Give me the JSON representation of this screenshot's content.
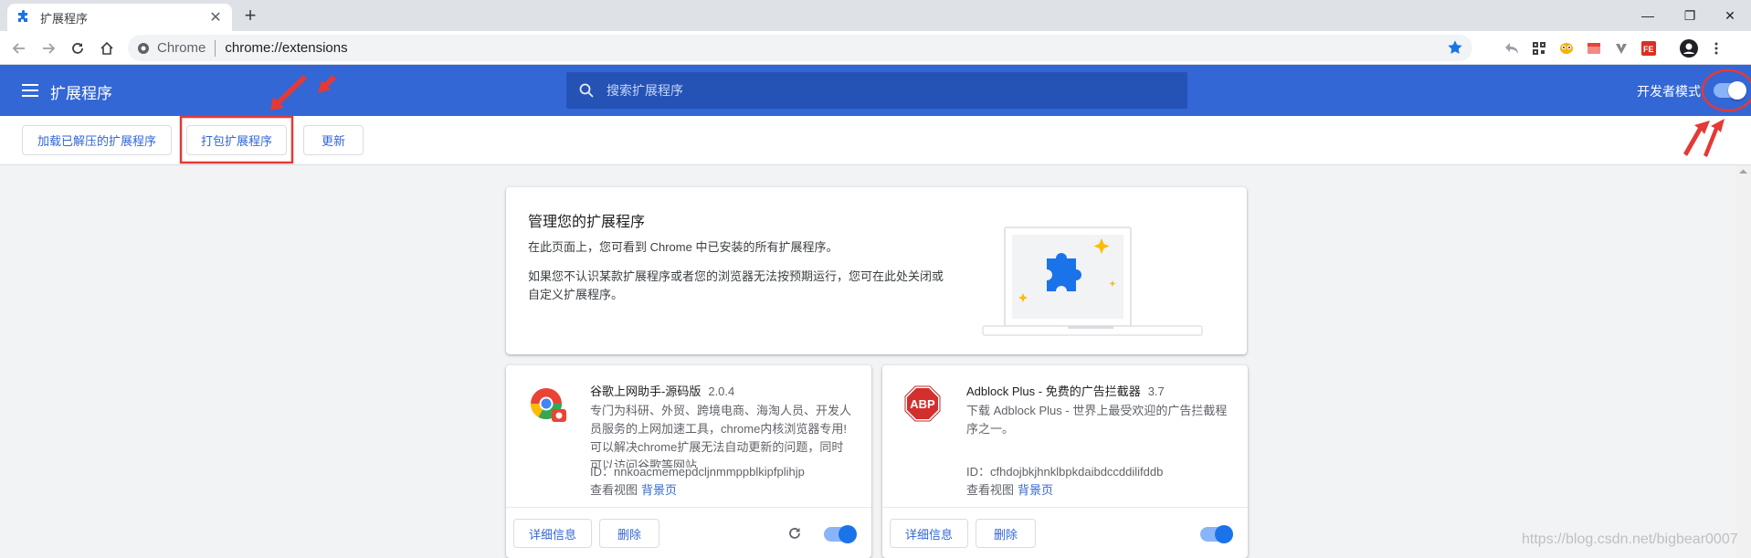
{
  "browser": {
    "tab_title": "扩展程序",
    "new_tab_symbol": "+",
    "omnibox_chip": "Chrome",
    "url": "chrome://extensions",
    "window_controls": [
      "minimize-icon",
      "restore-icon",
      "close-icon"
    ]
  },
  "colors": {
    "header_blue": "#3367d6",
    "link_blue": "#3367d6",
    "annotation_red": "#e53935",
    "star_blue": "#1a73e8"
  },
  "header": {
    "title": "扩展程序",
    "search_placeholder": "搜索扩展程序",
    "dev_mode_label": "开发者模式",
    "dev_mode_on": true
  },
  "devbar": {
    "load_unpacked": "加载已解压的扩展程序",
    "pack": "打包扩展程序",
    "update": "更新"
  },
  "manager_card": {
    "title": "管理您的扩展程序",
    "line1": "在此页面上，您可看到 Chrome 中已安装的所有扩展程序。",
    "line2": "如果您不认识某款扩展程序或者您的浏览器无法按预期运行，您可在此处关闭或",
    "line3": "自定义扩展程序。"
  },
  "extensions": [
    {
      "name": "谷歌上网助手-源码版",
      "version": "2.0.4",
      "desc_lines": [
        "专门为科研、外贸、跨境电商、海淘人员、开发人",
        "员服务的上网加速工具，chrome内核浏览器专用!",
        "可以解决chrome扩展无法自动更新的问题，同时",
        "可以访问谷歌等网站…"
      ],
      "id": "ID：nnkoacmemepdcljnmmppblkipfplihjp",
      "views_label": "查看视图",
      "views_link": "背景页",
      "details": "详细信息",
      "remove": "删除",
      "enabled": true
    },
    {
      "name": "Adblock Plus - 免费的广告拦截器",
      "version": "3.7",
      "desc_lines": [
        "下载 Adblock Plus - 世界上最受欢迎的广告拦截程",
        "序之一。"
      ],
      "id": "ID：cfhdojbkjhnklbpkdaibdccddilifddb",
      "views_label": "查看视图",
      "views_link": "背景页",
      "details": "详细信息",
      "remove": "删除",
      "enabled": true,
      "icon_text": "ABP"
    }
  ],
  "watermark": "https://blog.csdn.net/bigbear0007"
}
